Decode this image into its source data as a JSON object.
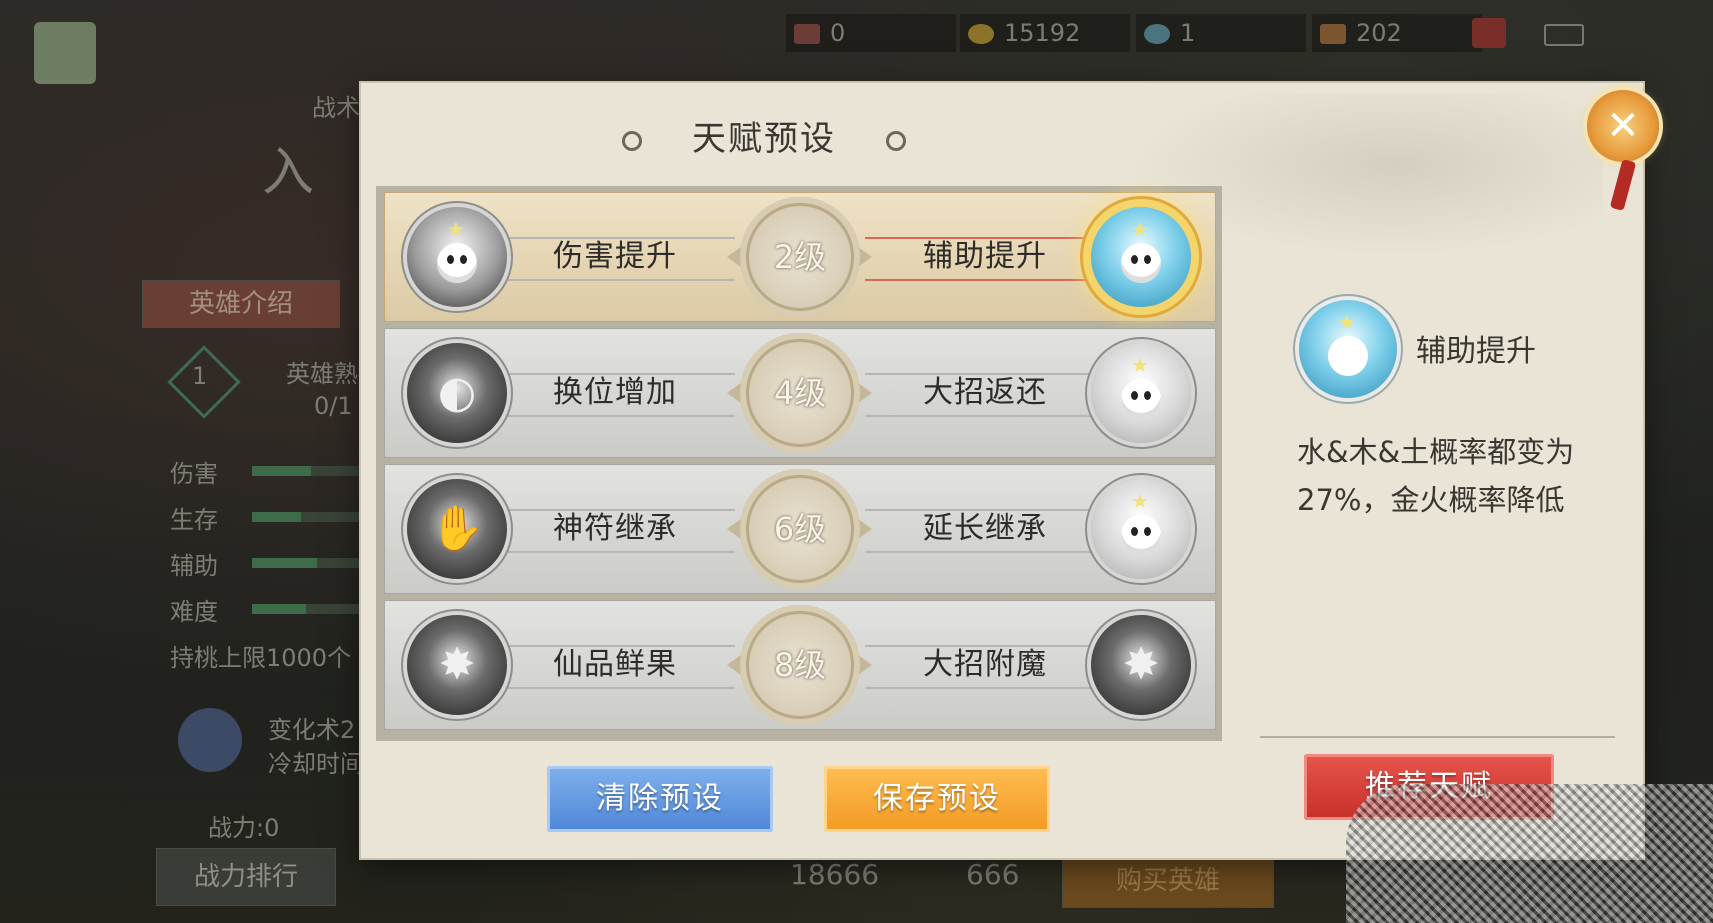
{
  "topbar": {
    "items": [
      {
        "icon": "ticket-icon",
        "value": "0"
      },
      {
        "icon": "gold-coin-icon",
        "value": "15192"
      },
      {
        "icon": "jade-icon",
        "value": "1"
      },
      {
        "icon": "gate-icon",
        "value": "202"
      }
    ]
  },
  "background": {
    "section_label": "战术",
    "hero_name": "入",
    "intro_tab": "英雄介绍",
    "proficiency_label": "英雄熟",
    "proficiency_value": "0/1",
    "rank_number": "1",
    "stats": [
      {
        "label": "伤害",
        "fill": 0.55
      },
      {
        "label": "生存",
        "fill": 0.45
      },
      {
        "label": "辅助",
        "fill": 0.6
      },
      {
        "label": "难度",
        "fill": 0.5
      }
    ],
    "peach_limit": "持桃上限1000个",
    "skill_name": "变化术2",
    "skill_cd": "冷却时间",
    "power": "战力:0",
    "power_rank_btn": "战力排行",
    "price_gold": "18666",
    "price_gate": "666",
    "buy_btn": "购买英雄"
  },
  "dialog": {
    "title": "天赋预设",
    "rows": [
      {
        "level": "2级",
        "left": "伤害提升",
        "right": "辅助提升",
        "selected": "right"
      },
      {
        "level": "4级",
        "left": "换位增加",
        "right": "大招返还",
        "selected": "none"
      },
      {
        "level": "6级",
        "left": "神符继承",
        "right": "延长继承",
        "selected": "none"
      },
      {
        "level": "8级",
        "left": "仙品鲜果",
        "right": "大招附魔",
        "selected": "none"
      }
    ],
    "detail": {
      "name": "辅助提升",
      "description": "水&木&土概率都变为27%，金火概率降低"
    },
    "buttons": {
      "clear": "清除预设",
      "save": "保存预设",
      "recommend": "推荐天赋"
    }
  },
  "colors": {
    "clear_button": "#5b8fdc",
    "save_button": "#f6a12c",
    "recommend_button": "#d33a32",
    "selected_glow": "#f3d56b"
  }
}
